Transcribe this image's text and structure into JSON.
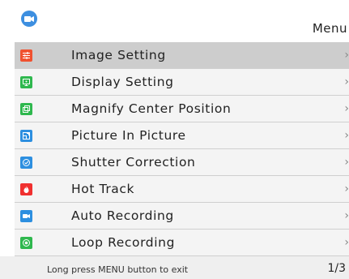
{
  "header": {
    "title": "Menu"
  },
  "menu": {
    "items": [
      {
        "label": "Image Setting",
        "icon": "sliders-icon",
        "color": "#f0512f",
        "chevron": "›",
        "selected": true
      },
      {
        "label": "Display Setting",
        "icon": "display-icon",
        "color": "#2fb84e",
        "chevron": "›"
      },
      {
        "label": "Magnify Center Position",
        "icon": "magnify-icon",
        "color": "#2fb84e",
        "chevron": "›"
      },
      {
        "label": "Picture In Picture",
        "icon": "pip-icon",
        "color": "#2d8fe0",
        "chevron": "›"
      },
      {
        "label": "Shutter Correction",
        "icon": "shutter-icon",
        "color": "#2d8fe0",
        "chevron": "›"
      },
      {
        "label": "Hot Track",
        "icon": "flame-icon",
        "color": "#f0302f",
        "chevron": "›"
      },
      {
        "label": "Auto Recording",
        "icon": "camera-icon",
        "color": "#2d8fe0",
        "chevron": "›"
      },
      {
        "label": "Loop Recording",
        "icon": "loop-icon",
        "color": "#2fb84e",
        "chevron": "›"
      }
    ]
  },
  "footer": {
    "hint": "Long press MENU button to exit",
    "page": "1/3"
  },
  "colors": {
    "app_icon": "#3d8fe0",
    "selected_row": "#cdcdcd",
    "row": "#f4f4f4"
  }
}
